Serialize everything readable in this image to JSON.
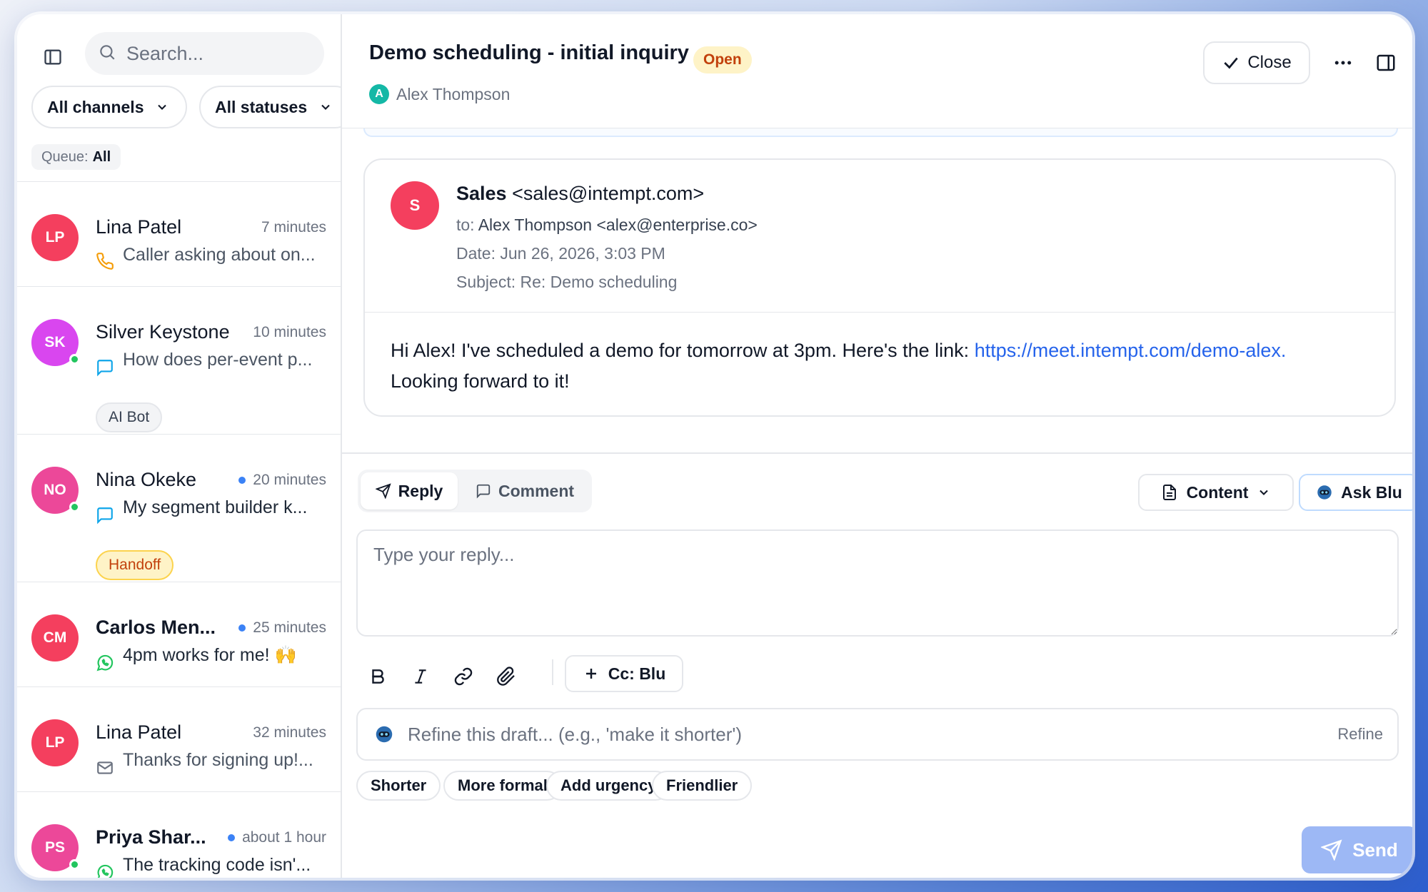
{
  "sidebar": {
    "search_placeholder": "Search...",
    "filters": [
      {
        "label": "All channels"
      },
      {
        "label": "All statuses"
      }
    ],
    "queue": {
      "label": "Queue:",
      "value": "All"
    },
    "conversations": [
      {
        "initials": "LP",
        "name": "Lina Patel",
        "time": "7 minutes",
        "unread": false,
        "channel": "phone",
        "preview": "Caller asking about on...",
        "online": false,
        "avatar_color": "#f43f5e"
      },
      {
        "initials": "SK",
        "name": "Silver Keystone",
        "time": "10 minutes",
        "unread": false,
        "channel": "chat",
        "preview": "How does per-event p...",
        "online": true,
        "avatar_color": "#d946ef",
        "tag": "AI Bot"
      },
      {
        "initials": "NO",
        "name": "Nina Okeke",
        "time": "20 minutes",
        "unread": true,
        "channel": "chat",
        "preview": "My segment builder k...",
        "online": true,
        "avatar_color": "#ec4899",
        "tag": "Handoff"
      },
      {
        "initials": "CM",
        "name": "Carlos Men...",
        "time": "25 minutes",
        "unread": true,
        "channel": "whatsapp",
        "preview": "4pm works for me! 🙌",
        "online": false,
        "avatar_color": "#f43f5e"
      },
      {
        "initials": "LP",
        "name": "Lina Patel",
        "time": "32 minutes",
        "unread": false,
        "channel": "email",
        "preview": "Thanks for signing up!...",
        "online": false,
        "avatar_color": "#f43f5e"
      },
      {
        "initials": "PS",
        "name": "Priya Shar...",
        "time": "about 1 hour",
        "unread": true,
        "channel": "whatsapp",
        "preview": "The tracking code isn'...",
        "online": true,
        "avatar_color": "#ec4899"
      }
    ]
  },
  "header": {
    "title": "Demo scheduling - initial inquiry",
    "status": "Open",
    "contact_initial": "A",
    "contact_name": "Alex Thompson",
    "close_label": "Close"
  },
  "email": {
    "avatar_initial": "S",
    "from_name": "Sales",
    "from_address": "<sales@intempt.com>",
    "to_label": "to:",
    "to_value": "Alex Thompson <alex@enterprise.co>",
    "date": "Date: Jun 26, 2026, 3:03 PM",
    "subject": "Subject: Re: Demo scheduling",
    "body_text": "Hi Alex! I've scheduled a demo for tomorrow at 3pm. Here's the link: ",
    "body_link": "https://meet.intempt.com/demo-alex.",
    "body_text2": "Looking forward to it!"
  },
  "composer": {
    "tab_reply": "Reply",
    "tab_comment": "Comment",
    "content_label": "Content",
    "ask_blu_label": "Ask Blu",
    "reply_placeholder": "Type your reply...",
    "cc_label": "Cc: Blu",
    "refine_placeholder": "Refine this draft... (e.g., 'make it shorter')",
    "refine_label": "Refine",
    "chips": [
      "Shorter",
      "More formal",
      "Add urgency",
      "Friendlier"
    ],
    "send_label": "Send"
  },
  "colors": {
    "accent": "#2563eb",
    "open_badge_bg": "#fef3c7",
    "open_badge_text": "#c2410c",
    "online": "#22c55e",
    "send_disabled": "#9db8f5"
  }
}
